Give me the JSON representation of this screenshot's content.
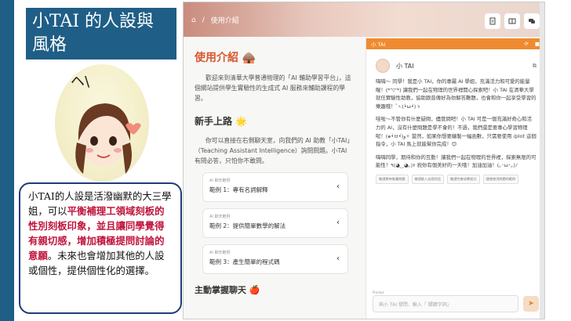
{
  "slide": {
    "title": "小TAI 的人設與風格",
    "description": {
      "p1": "小TAI的人設是活潑幽默的大三學姐，可以",
      "h1": "平衡補理工領域刻板的性別刻板印象，並且讓同學覺得有親切感，增加積極提問討論的意願",
      "p2": "。未來也會增加其他的人設或個性，提供個性化的選擇。"
    },
    "avatar_text": "ヘ\\"
  },
  "app": {
    "breadcrumb": {
      "home_icon": "home-icon",
      "sep": "/",
      "current": "使用介紹"
    },
    "header_buttons": [
      "document-icon",
      "layout-icon",
      "chat-icon"
    ],
    "content": {
      "intro_heading": "使用介紹 🛖",
      "intro_text": "歡迎來到清華大學普通物理的「AI 輔助學習平台」，這個網站提供學生實驗性的生成式 AI 服務來輔助課程的學習。",
      "beginner_heading": "新手上路 🌟",
      "beginner_text": "你可以直接在右側聊天室，向我們的 AI 助教「小TAI」（Teaching Assistant Intelligence）詢問問題。小TAI 有問必答，只怕你不敢問。",
      "examples": [
        {
          "tag": "AI 聊天範例",
          "title": "範例 1：專有名詞解釋"
        },
        {
          "tag": "AI 聊天範例",
          "title": "範例 2：提供簡單數學的解法"
        },
        {
          "tag": "AI 聊天範例",
          "title": "範例 3：產生簡單的程式碼"
        }
      ],
      "master_heading": "主動掌握聊天 🍎"
    },
    "chat": {
      "bar_title": "小 TAI",
      "bot_name": "小 TAI",
      "messages": [
        "嗨嗨～ 同學！我是小 TAI，你的專屬 AI 學姐，充滿活力和可愛的能量喔！(*'▽'*) 讓我們一起在物理的世界裡開心探索吧！小 TAI 在清華大學就任實驗性助教，協助跟普傳好為你解答難題，也會和你一起享受學習的樂趣哦！ ゚ヽ(•̀ω•́)ゝ",
        "哇啦～不管你有什麼疑問，儘管問吧！小 TAI 可是一個充滿好奇心和活力的 AI，沒有什麼問題是學不會的！不過，我們還是要專心學習物理呢！(๑•̀ㅂ•́)و✧ 當然，如果你想要繪製一幅函數，只需要使用 /plot 這個指令，小 TAI 馬上就能幫你完成！😊",
        "嗨嗨同學，期待和你的互動！讓我們一起在物理的世界裡，探索無限的可能性！٩(◕‿◕｡)۶ 祝你有個美好的一天哦！加油加油！(｡･ω･｡)ﾉ"
      ],
      "chips": [
        "敬請期待推薦問題",
        "敬請推入自我對話",
        "敬請完善成教程式",
        "隨便使用問題的範例"
      ],
      "input_label": "Prompt",
      "input_placeholder": "與小 TAI 發問、輸入「 關鍵字詞」",
      "send_icon": "send-icon"
    }
  }
}
